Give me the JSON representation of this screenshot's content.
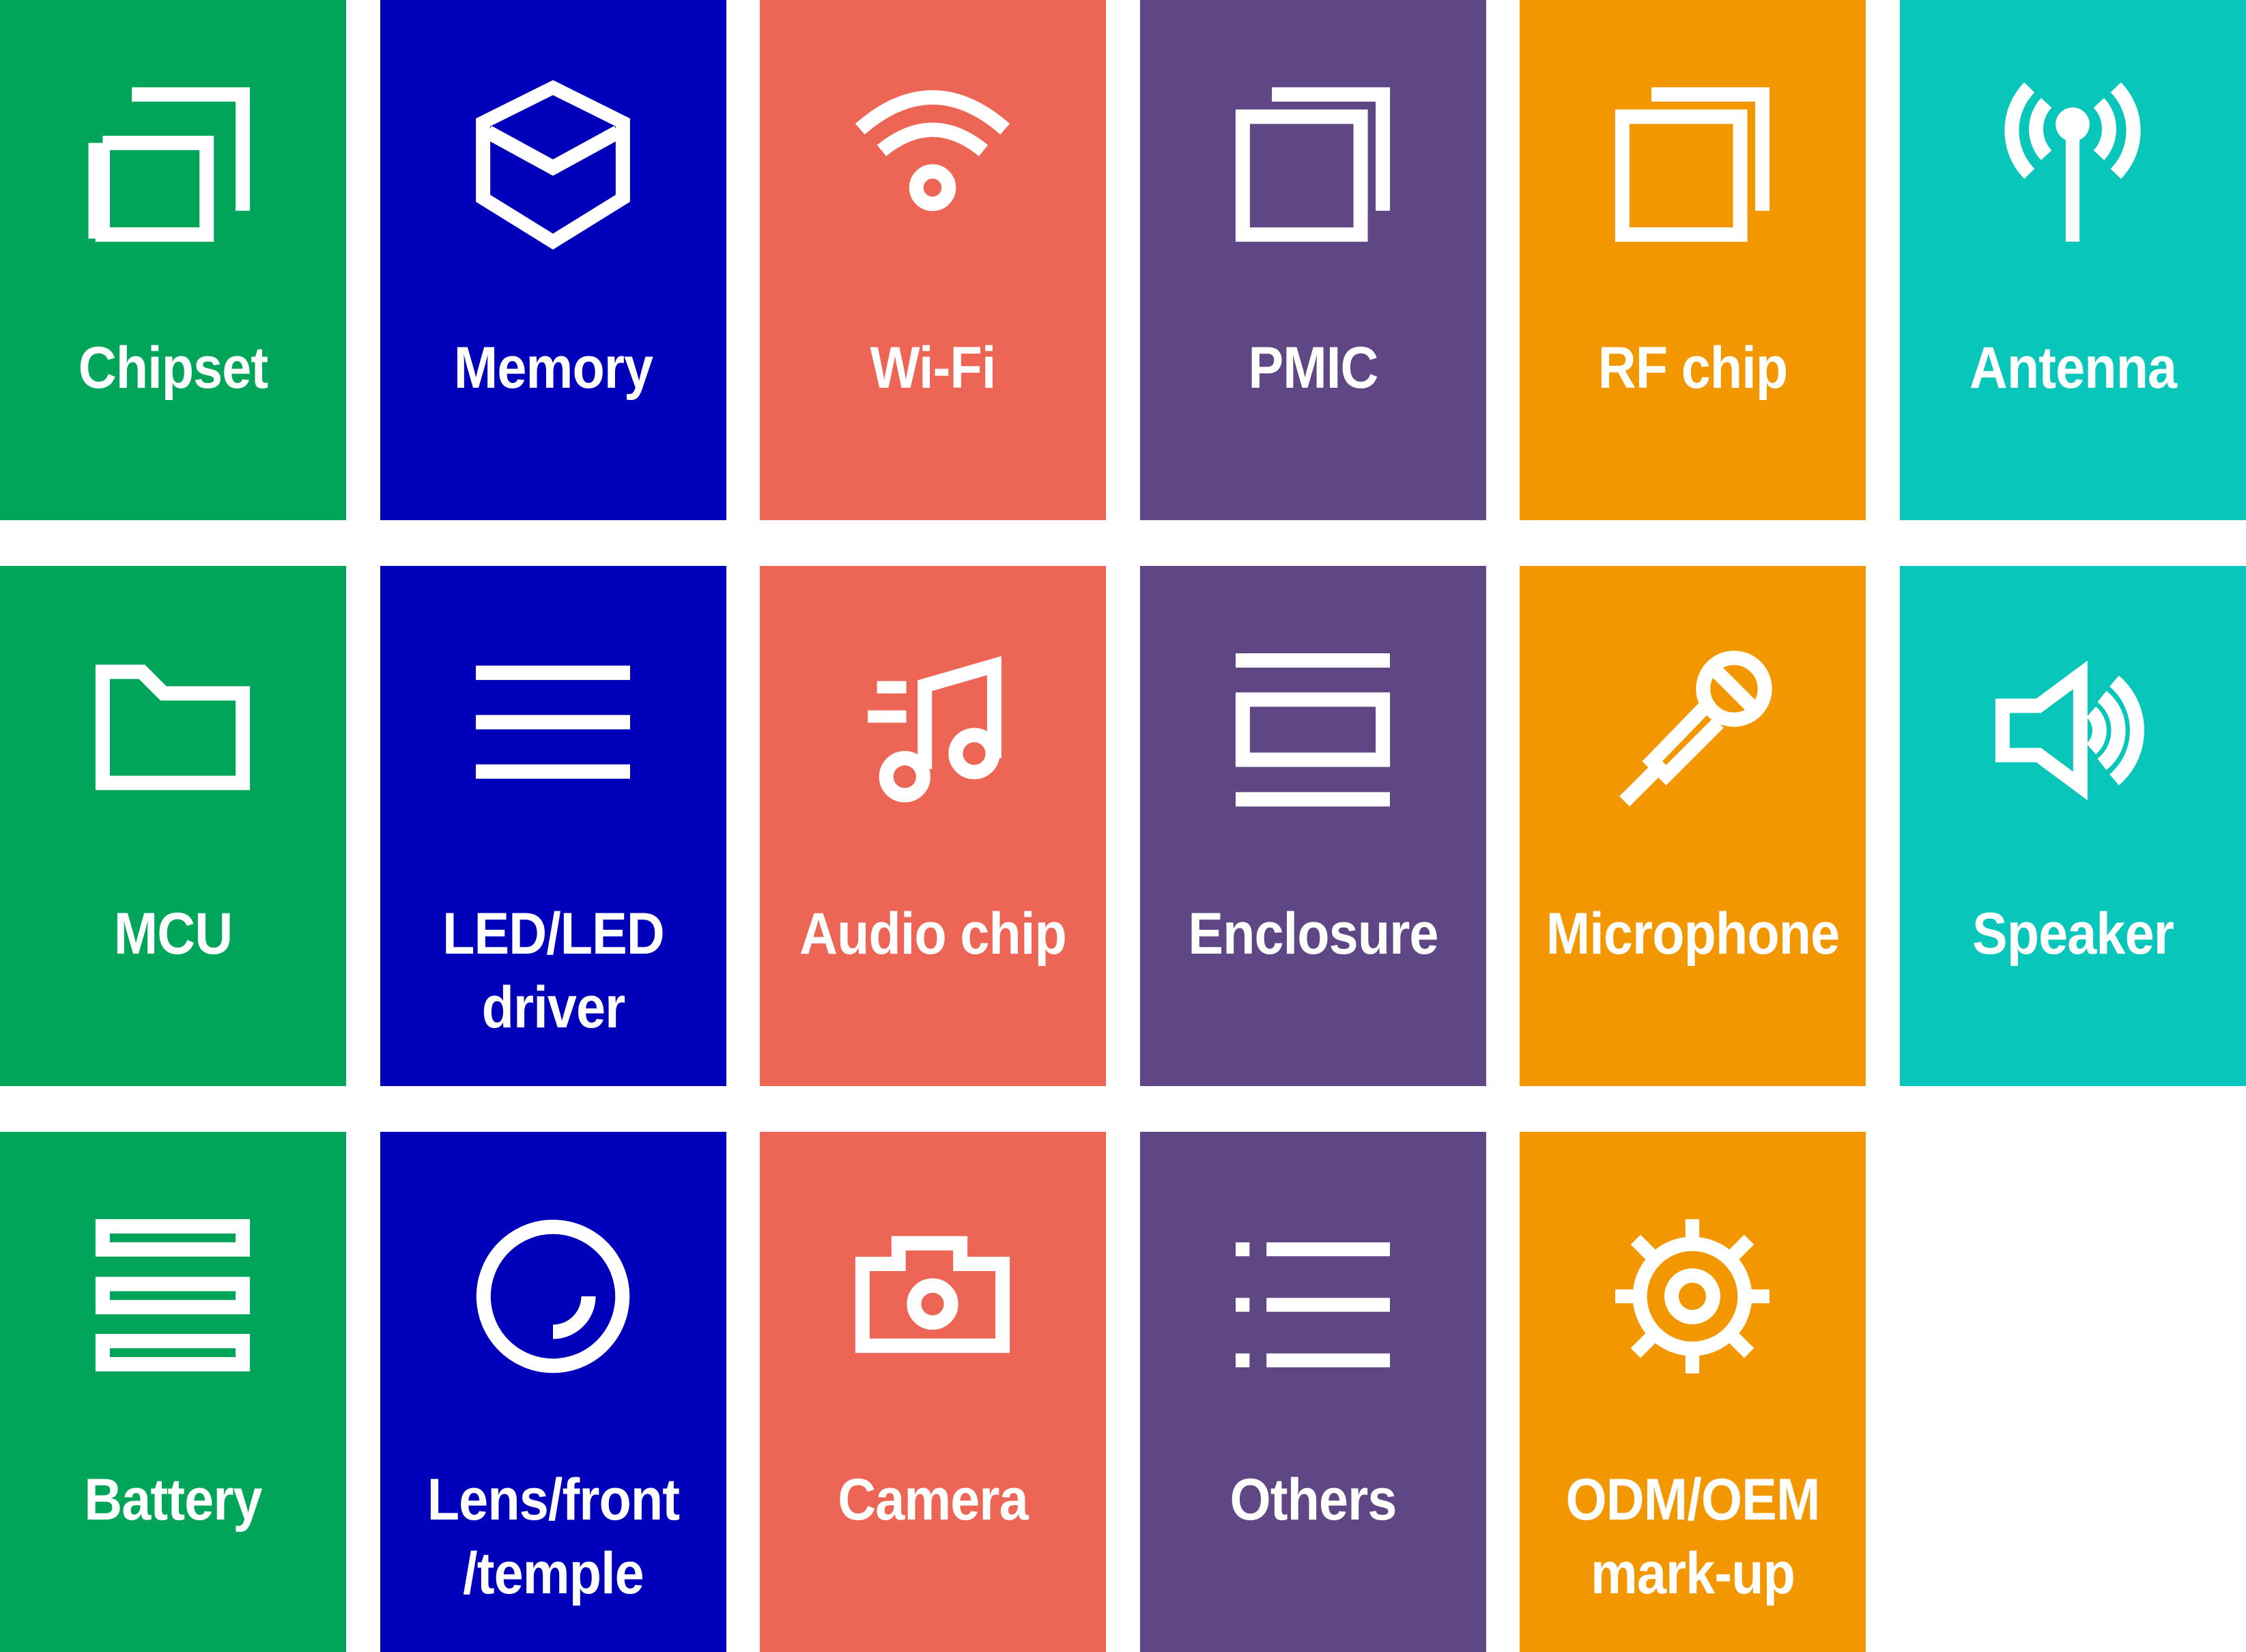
{
  "colors": {
    "green": "#00a55a",
    "blue": "#0000bb",
    "coral": "#ec6555",
    "purple": "#5f4785",
    "orange": "#f39700",
    "teal": "#09c6ba",
    "icon": "#ffffff",
    "background": "#ffffff"
  },
  "tiles": [
    {
      "label": [
        "Chipset"
      ],
      "icon": "copy-squares-icon",
      "color": "green"
    },
    {
      "label": [
        "Memory"
      ],
      "icon": "cube-icon",
      "color": "blue"
    },
    {
      "label": [
        "Wi-Fi"
      ],
      "icon": "wifi-icon",
      "color": "coral"
    },
    {
      "label": [
        "PMIC"
      ],
      "icon": "copy-squares-icon",
      "color": "purple"
    },
    {
      "label": [
        "RF chip"
      ],
      "icon": "copy-squares-icon",
      "color": "orange"
    },
    {
      "label": [
        "Antenna"
      ],
      "icon": "antenna-icon",
      "color": "teal"
    },
    {
      "label": [
        "MCU"
      ],
      "icon": "folder-icon",
      "color": "green"
    },
    {
      "label": [
        "LED/LED",
        "driver"
      ],
      "icon": "menu-lines-icon",
      "color": "blue"
    },
    {
      "label": [
        "Audio chip"
      ],
      "icon": "music-note-icon",
      "color": "coral"
    },
    {
      "label": [
        "Enclosure"
      ],
      "icon": "enclosure-icon",
      "color": "purple"
    },
    {
      "label": [
        "Microphone"
      ],
      "icon": "microphone-icon",
      "color": "orange"
    },
    {
      "label": [
        "Speaker"
      ],
      "icon": "speaker-icon",
      "color": "teal"
    },
    {
      "label": [
        "Battery"
      ],
      "icon": "stacked-bars-icon",
      "color": "green"
    },
    {
      "label": [
        "Lens/front",
        "/temple"
      ],
      "icon": "lens-icon",
      "color": "blue"
    },
    {
      "label": [
        "Camera"
      ],
      "icon": "camera-icon",
      "color": "coral"
    },
    {
      "label": [
        "Others"
      ],
      "icon": "list-icon",
      "color": "purple"
    },
    {
      "label": [
        "ODM/OEM",
        "mark-up"
      ],
      "icon": "gear-icon",
      "color": "orange"
    }
  ]
}
